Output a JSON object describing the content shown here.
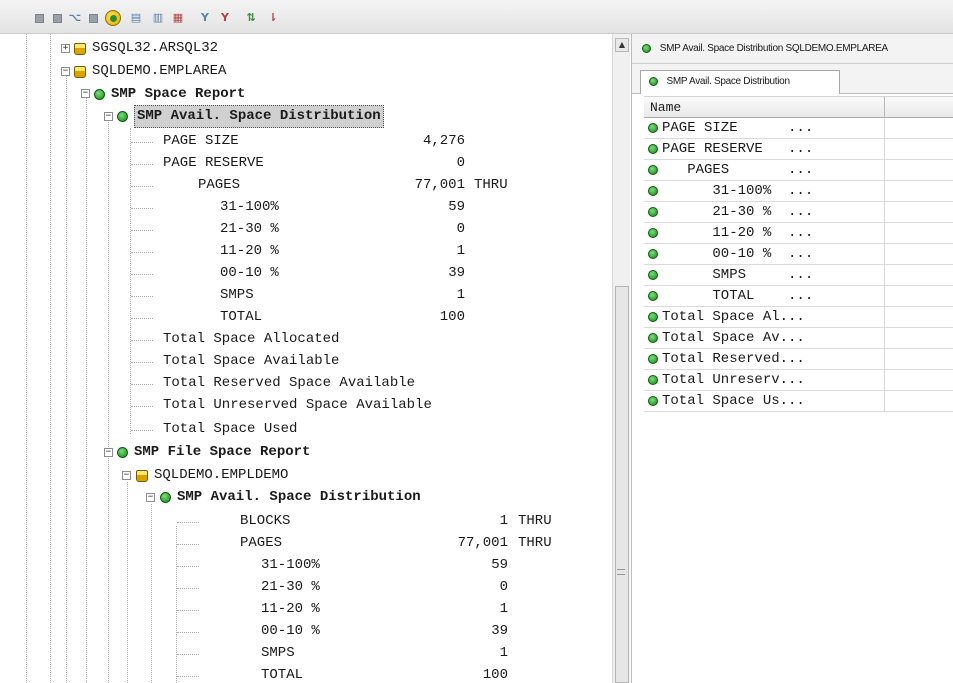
{
  "tree": {
    "databases": [
      {
        "label": "SGSQL32.ARSQL32"
      },
      {
        "label": "SQLDEMO.EMPLAREA"
      }
    ],
    "space_report": {
      "label": "SMP Space Report",
      "distribution": {
        "label": "SMP Avail. Space Distribution",
        "rows": [
          {
            "name": "PAGE SIZE",
            "value": "4,276",
            "suffix": ""
          },
          {
            "name": "PAGE RESERVE",
            "value": "0",
            "suffix": ""
          },
          {
            "name": "PAGES",
            "value": "77,001",
            "suffix": "THRU"
          },
          {
            "name": "31-100%",
            "value": "59",
            "suffix": ""
          },
          {
            "name": "21-30 %",
            "value": "0",
            "suffix": ""
          },
          {
            "name": "11-20 %",
            "value": "1",
            "suffix": ""
          },
          {
            "name": "00-10 %",
            "value": "39",
            "suffix": ""
          },
          {
            "name": "SMPS",
            "value": "1",
            "suffix": ""
          },
          {
            "name": "TOTAL",
            "value": "100",
            "suffix": ""
          }
        ],
        "summary": [
          "Total Space Allocated",
          "Total Space Available",
          "Total Reserved Space Available",
          "Total Unreserved Space Available",
          "Total Space Used"
        ]
      }
    },
    "file_report": {
      "label": "SMP File Space Report",
      "file": {
        "label": "SQLDEMO.EMPLDEMO",
        "distribution": {
          "label": "SMP Avail. Space Distribution",
          "rows": [
            {
              "name": "BLOCKS",
              "value": "1",
              "suffix": "THRU"
            },
            {
              "name": "PAGES",
              "value": "77,001",
              "suffix": "THRU"
            },
            {
              "name": "31-100%",
              "value": "59",
              "suffix": ""
            },
            {
              "name": "21-30 %",
              "value": "0",
              "suffix": ""
            },
            {
              "name": "11-20 %",
              "value": "1",
              "suffix": ""
            },
            {
              "name": "00-10 %",
              "value": "39",
              "suffix": ""
            },
            {
              "name": "SMPS",
              "value": "1",
              "suffix": ""
            },
            {
              "name": "TOTAL",
              "value": "100",
              "suffix": ""
            }
          ]
        }
      }
    }
  },
  "right_pane": {
    "title": "SMP Avail. Space Distribution  SQLDEMO.EMPLAREA",
    "tab_label": "SMP Avail. Space Distribution",
    "grid": {
      "column_name": "Name",
      "rows": [
        "PAGE SIZE      ...",
        "PAGE RESERVE   ...",
        "   PAGES       ...",
        "      31-100%  ...",
        "      21-30 %  ...",
        "      11-20 %  ...",
        "      00-10 %  ...",
        "      SMPS     ...",
        "      TOTAL    ...",
        "Total Space Al...",
        "Total Space Av...",
        "Total Reserved...",
        "Total Unreserv...",
        "Total Space Us..."
      ]
    }
  },
  "colors": {
    "node_green": "#138a13",
    "db_yellow": "#d9a400",
    "selection": "#d0d0d0"
  },
  "icons": {
    "toolbar": [
      "square-icon",
      "square-icon",
      "tree-icon",
      "square-icon",
      "refresh-icon",
      "report-icon",
      "report-icon",
      "report-icon",
      "filter-icon",
      "filter-icon",
      "sort-icon",
      "sort-icon"
    ]
  }
}
